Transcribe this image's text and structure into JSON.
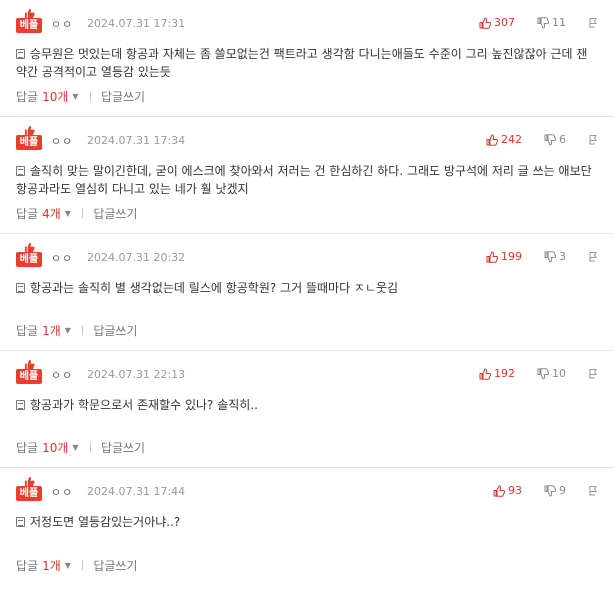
{
  "comments": [
    {
      "badge": "베플",
      "user": "ㅇㅇ",
      "date": "2024.07.31 17:31",
      "likes": "307",
      "dislikes": "11",
      "text": "승무원은 멋있는데 항공과 자체는 좀 쓸모없는건 팩트라고 생각함 다니는애들도 수준이 그리 높진않잖아 근데 잰 약간 공격적이고 열등감 있는듯",
      "reply_label": "답글",
      "reply_count": "10개",
      "write_label": "답글쓰기"
    },
    {
      "badge": "베플",
      "user": "ㅇㅇ",
      "date": "2024.07.31 17:34",
      "likes": "242",
      "dislikes": "6",
      "text": "솔직히 맞는 말이긴한데, 굳이 에스크에 찾아와서 저러는 건 한심하긴 하다. 그래도 방구석에 저리 글 쓰는 애보단 항공과라도 열심히 다니고 있는 네가 훨 낫겠지",
      "reply_label": "답글",
      "reply_count": "4개",
      "write_label": "답글쓰기"
    },
    {
      "badge": "베플",
      "user": "ㅇㅇ",
      "date": "2024.07.31 20:32",
      "likes": "199",
      "dislikes": "3",
      "text": "항공과는 솔직히 별 생각없는데 릴스에 항공학원? 그거 뜰때마다 ㅈㄴ웃김",
      "reply_label": "답글",
      "reply_count": "1개",
      "write_label": "답글쓰기"
    },
    {
      "badge": "베플",
      "user": "ㅇㅇ",
      "date": "2024.07.31 22:13",
      "likes": "192",
      "dislikes": "10",
      "text": "항공과가 학문으로서 존재할수 있나? 솔직히..",
      "reply_label": "답글",
      "reply_count": "10개",
      "write_label": "답글쓰기"
    },
    {
      "badge": "베플",
      "user": "ㅇㅇ",
      "date": "2024.07.31 17:44",
      "likes": "93",
      "dislikes": "9",
      "text": "저정도면 열등감있는거아냐..?",
      "reply_label": "답글",
      "reply_count": "1개",
      "write_label": "답글쓰기"
    }
  ],
  "colors": {
    "accent": "#d9372b",
    "badge_bg": "#e8402e"
  },
  "icons": [
    "thumbs-up-icon",
    "thumbs-down-icon",
    "report-flag-icon",
    "memo-icon",
    "caret-down-icon"
  ]
}
